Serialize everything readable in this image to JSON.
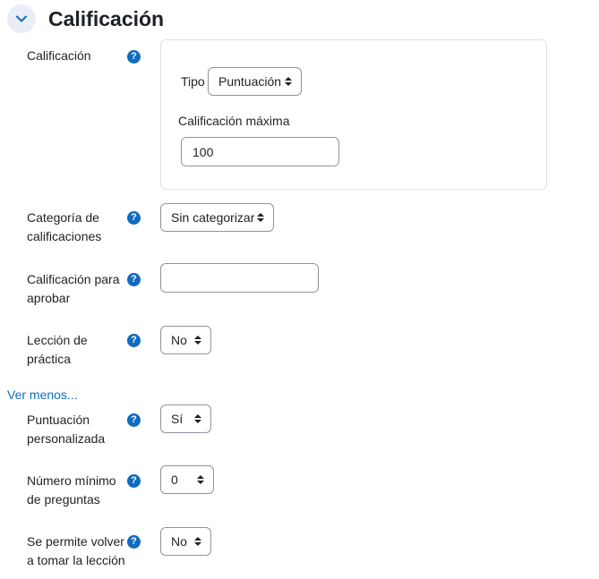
{
  "section": {
    "title": "Calificación"
  },
  "grade": {
    "label": "Calificación",
    "type_label": "Tipo",
    "type_value": "Puntuación",
    "max_label": "Calificación máxima",
    "max_value": "100"
  },
  "category": {
    "label": "Categoría de calificaciones",
    "value": "Sin categorizar"
  },
  "pass": {
    "label": "Calificación para aprobar",
    "value": ""
  },
  "practice": {
    "label": "Lección de práctica",
    "value": "No"
  },
  "show_less": "Ver menos...",
  "custom": {
    "label": "Puntuación personalizada",
    "value": "Sí"
  },
  "minq": {
    "label": "Número mínimo de preguntas",
    "value": "0"
  },
  "retake": {
    "label": "Se permite volver a tomar la lección",
    "value": "No"
  },
  "help_glyph": "?",
  "colors": {
    "accent": "#0f6cbf",
    "border": "#8f959e"
  }
}
